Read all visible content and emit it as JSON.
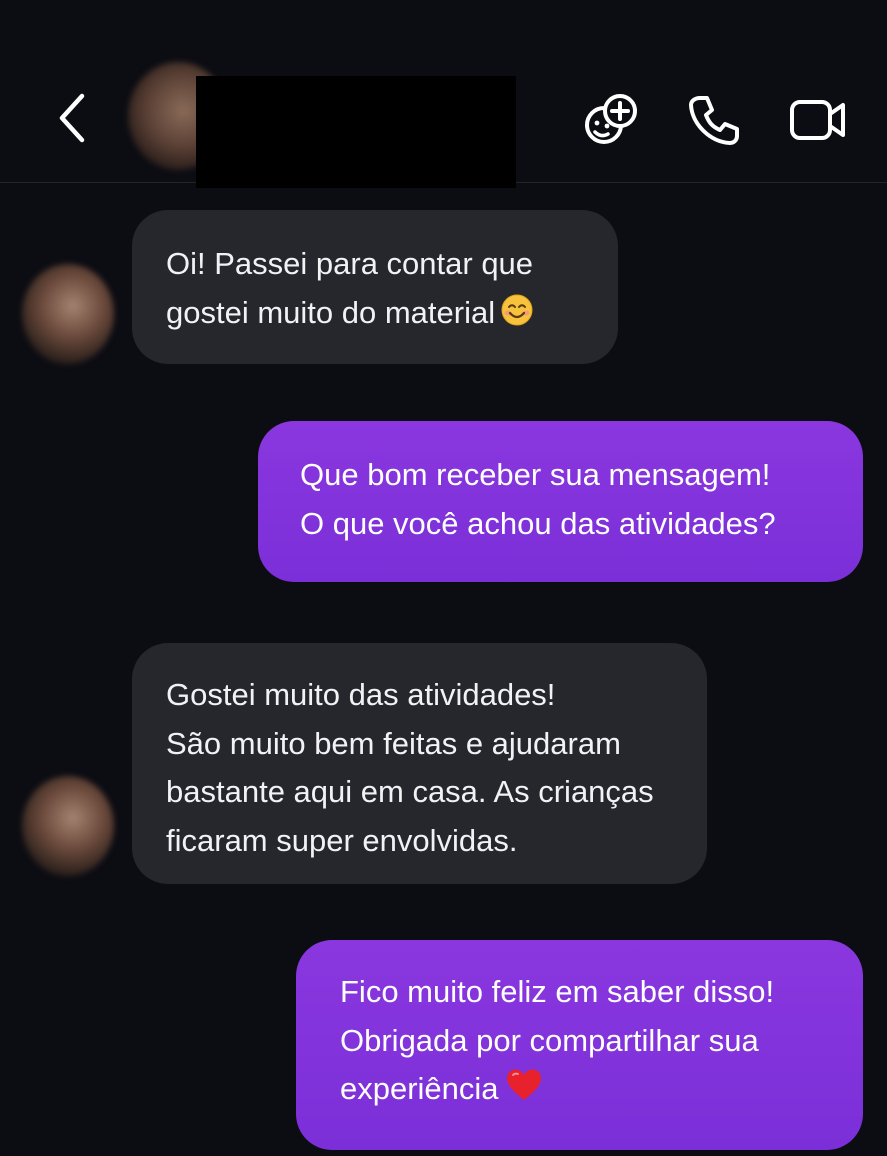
{
  "header": {
    "back_icon": "chevron-left-icon",
    "sticker_icon": "sticker-add-icon",
    "phone_icon": "phone-icon",
    "video_icon": "video-camera-icon"
  },
  "messages": [
    {
      "direction": "incoming",
      "lines": [
        "Oi! Passei para contar que",
        "gostei muito do material"
      ],
      "emoji": "smiling-face-emoji"
    },
    {
      "direction": "outgoing",
      "lines": [
        "Que bom receber sua mensagem!",
        "O que você achou das atividades?"
      ]
    },
    {
      "direction": "incoming",
      "lines": [
        "Gostei muito das atividades!",
        "São muito bem feitas e ajudaram",
        "bastante aqui em casa. As crianças",
        "ficaram super envolvidas."
      ]
    },
    {
      "direction": "outgoing",
      "lines": [
        "Fico muito feliz em saber disso!",
        "Obrigada por compartilhar sua",
        "experiência"
      ],
      "emoji": "red-heart-emoji"
    }
  ],
  "colors": {
    "background": "#0c0d13",
    "incoming_bubble": "#25272d",
    "outgoing_bubble": "#8a37df",
    "text": "#ffffff"
  }
}
